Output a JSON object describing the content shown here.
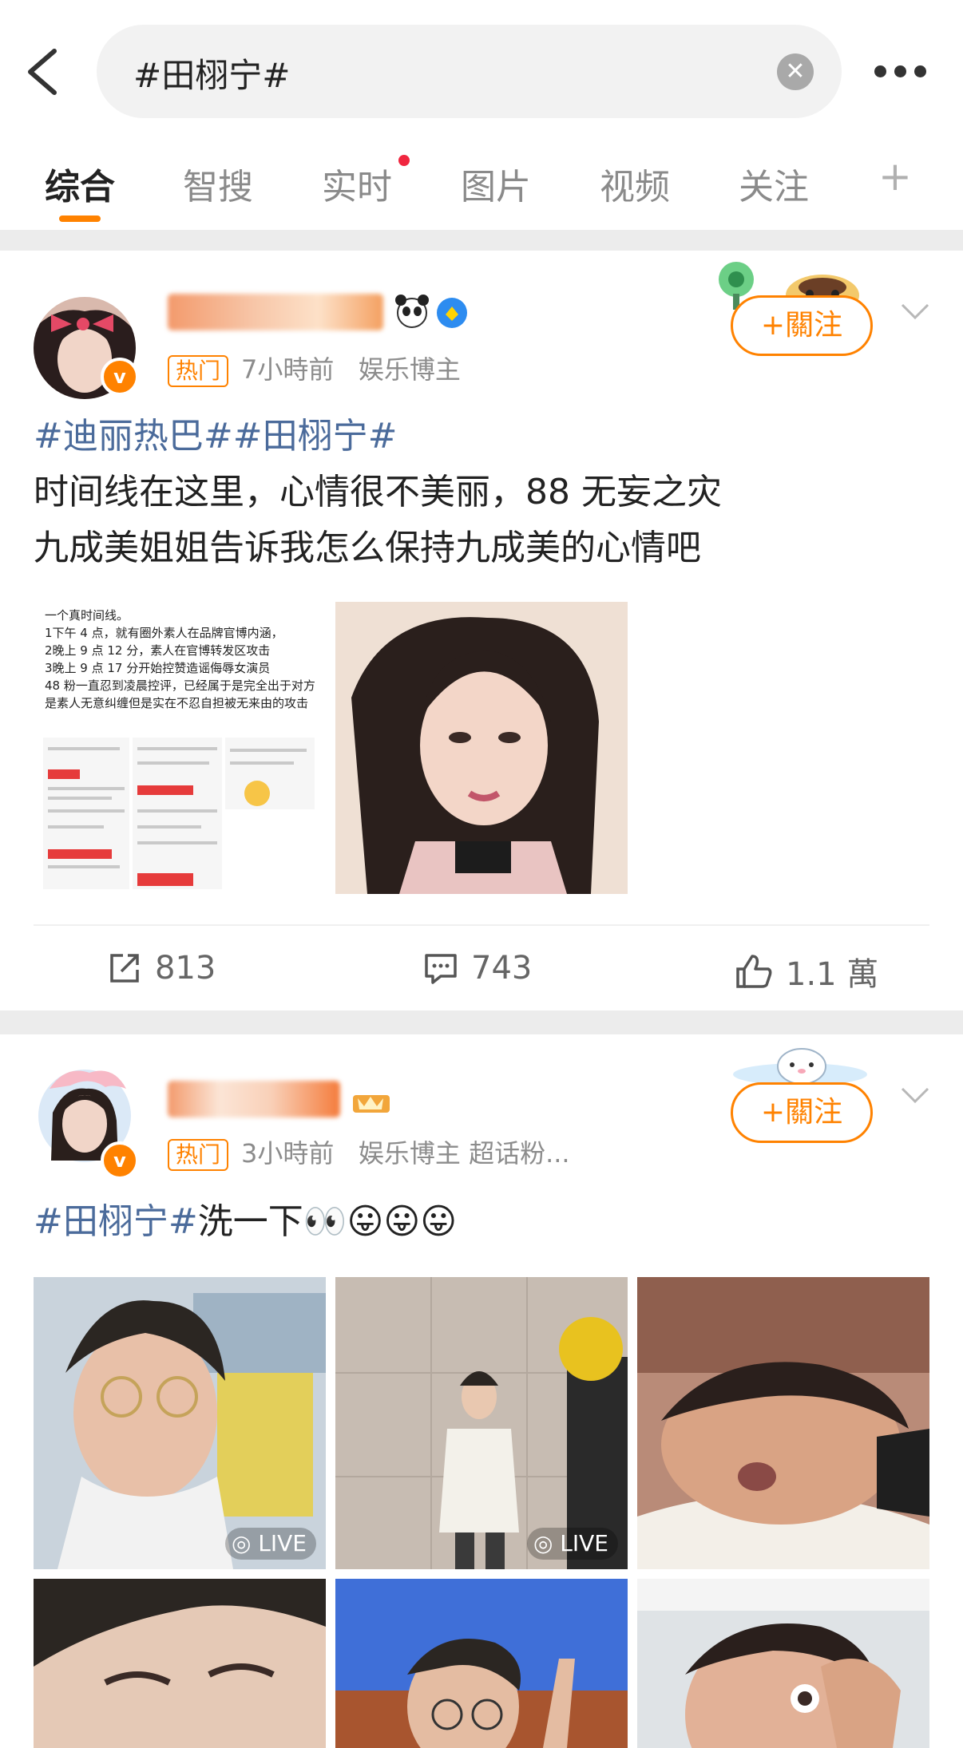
{
  "search": {
    "query": "#田栩宁#",
    "clear_icon": "close-circle-icon",
    "more_icon": "more-dots-icon"
  },
  "tabs": [
    {
      "label": "综合",
      "active": true
    },
    {
      "label": "智搜"
    },
    {
      "label": "实时",
      "has_red_dot": true
    },
    {
      "label": "图片"
    },
    {
      "label": "视频"
    },
    {
      "label": "关注"
    },
    {
      "label": "+"
    }
  ],
  "accent_color": "#ff8200",
  "topic_color": "#4b6b9b",
  "posts": [
    {
      "hot_tag": "热门",
      "time": "7小時前",
      "role": "娱乐博主",
      "follow_label": "+關注",
      "line1_topics": "#迪丽热巴##田栩宁#",
      "line2": "时间线在这里，心情很不美丽，88 无妄之灾",
      "line3": "九成美姐姐告诉我怎么保持九成美的心情吧",
      "screenshot_text": {
        "title": "一个真时间线。",
        "items": [
          "1下午 4 点，就有圈外素人在品牌官博内涵，",
          "2晚上 9 点 12 分，素人在官博转发区攻击",
          "3晚上 9 点 17 分开始控赞造谣侮辱女演员",
          "48 粉一直忍到凌晨控评，已经属于是完全出于对方是素人无意纠缠但是实在不忍自担被无来由的攻击"
        ]
      },
      "repost_count": "813",
      "comment_count": "743",
      "like_count": "1.1 萬"
    },
    {
      "hot_tag": "热门",
      "time": "3小時前",
      "role": "娱乐博主 超话粉...",
      "follow_label": "+關注",
      "topic": "#田栩宁#",
      "text": "洗一下👀😛😛😛",
      "live_label": "LIVE"
    }
  ]
}
